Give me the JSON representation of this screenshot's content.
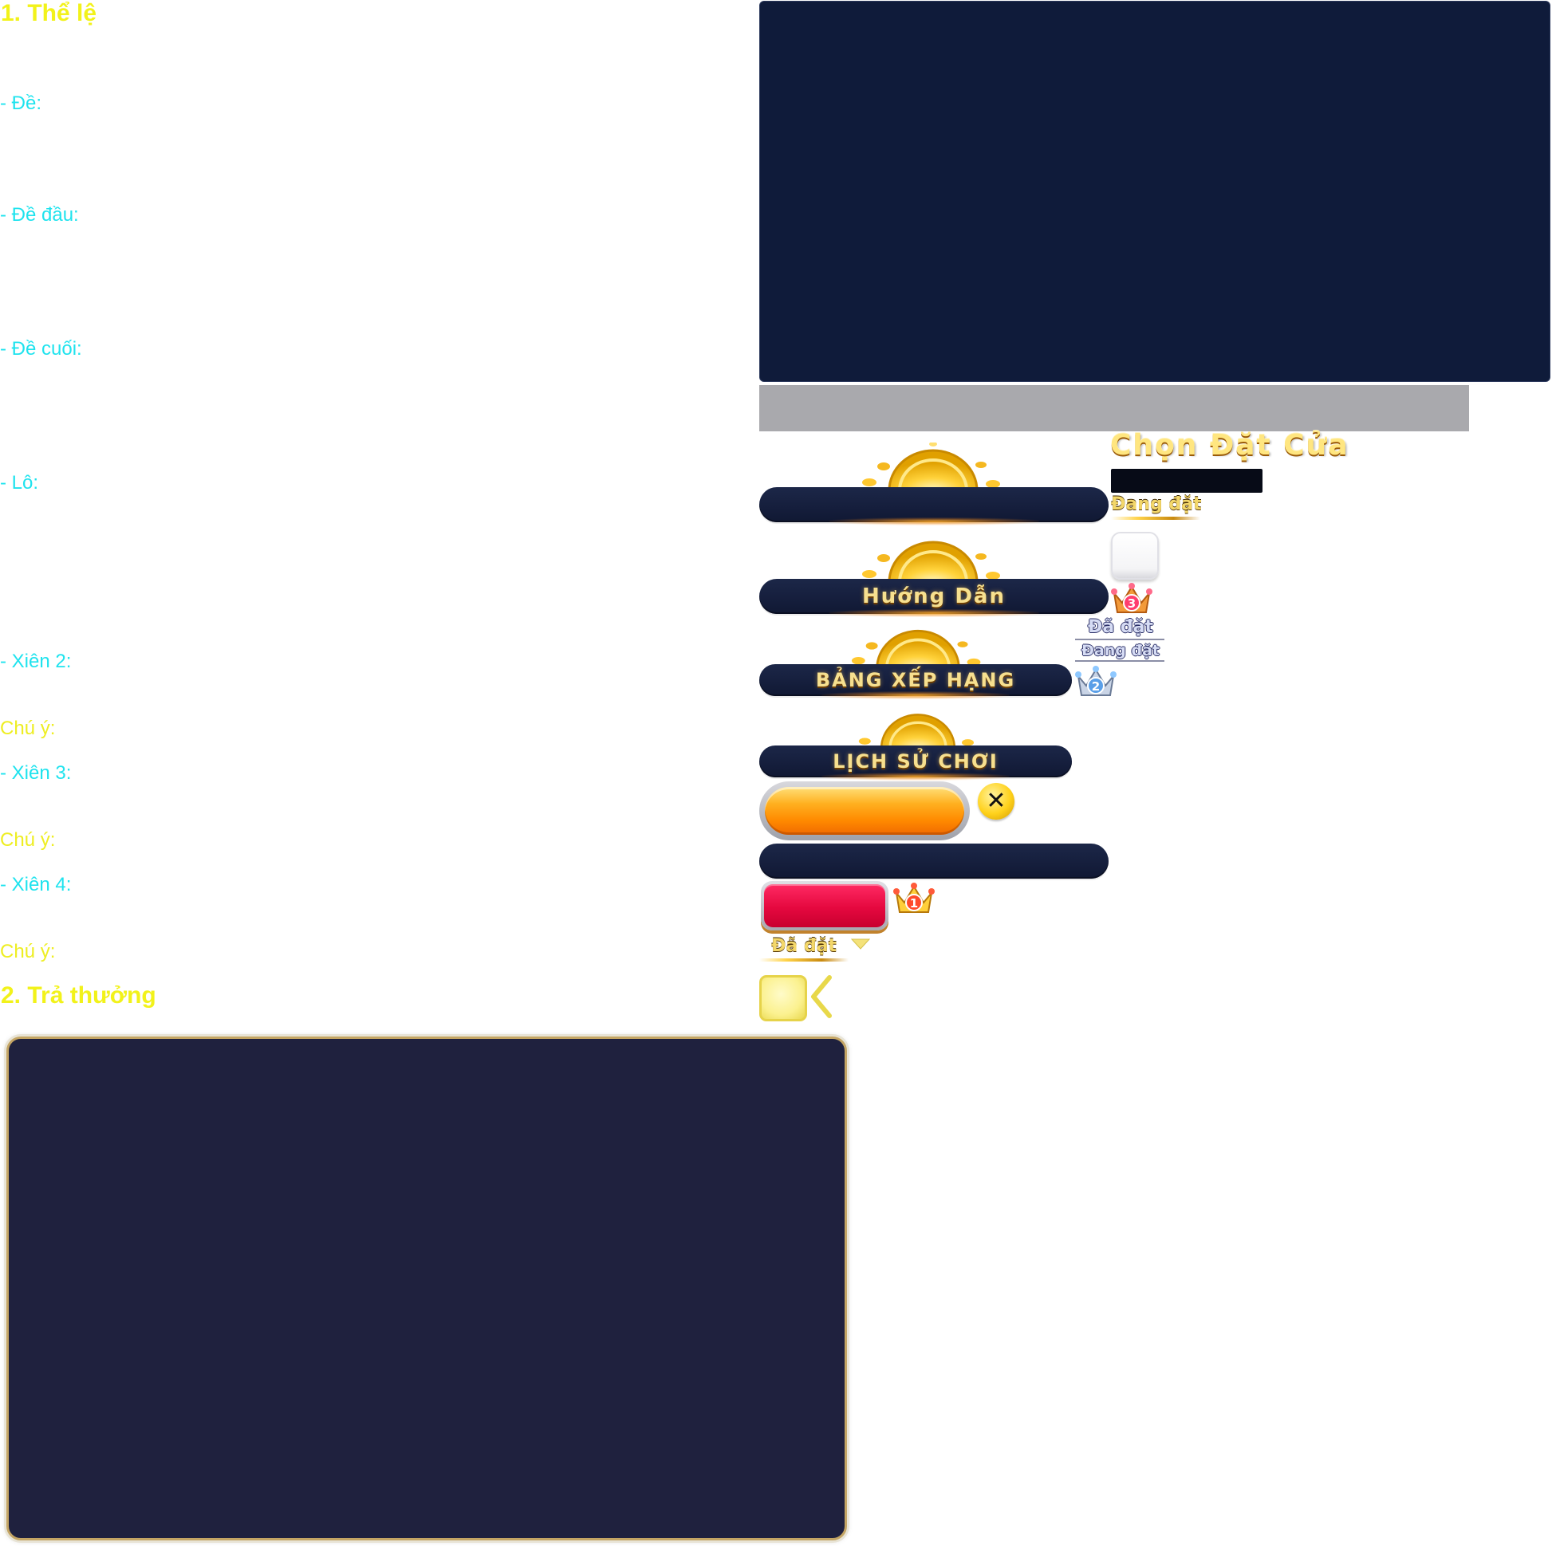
{
  "rules_sheet": {
    "section1_title": "1. Thể lệ",
    "items": {
      "de": "- Đề:",
      "de_dau": "- Đề đầu:",
      "de_cuoi": "- Đề cuối:",
      "lo": "- Lô:",
      "xien2": "- Xiên 2:",
      "note1": "Chú ý:",
      "xien3": "- Xiên 3:",
      "note2": "Chú ý:",
      "xien4": "- Xiên 4:",
      "note3": "Chú ý:"
    },
    "section2_title": "2. Trả thưởng"
  },
  "sprites": {
    "chon_dat_cua": "Chọn Đặt Cửa",
    "dang_dat_gold": "Đang đặt",
    "huong_dan": "Hướng Dẫn",
    "bang_xep_hang": "BẢNG XẾP HẠNG",
    "lich_su_choi": "LỊCH SỬ CHƠI",
    "da_dat_silver": "Đã đặt",
    "dang_dat_silver": "Đang đặt",
    "da_dat_gold": "Đã đặt",
    "rank_1": "1",
    "rank_2": "2",
    "rank_3": "3",
    "close_symbol": "✕"
  },
  "colors": {
    "heading_yellow": "#f2f21a",
    "rule_cyan": "#1fe3ee",
    "panel_navy": "#0f1b3a",
    "panel_dark": "#1f213e",
    "gold_text": "#f7e08f"
  }
}
